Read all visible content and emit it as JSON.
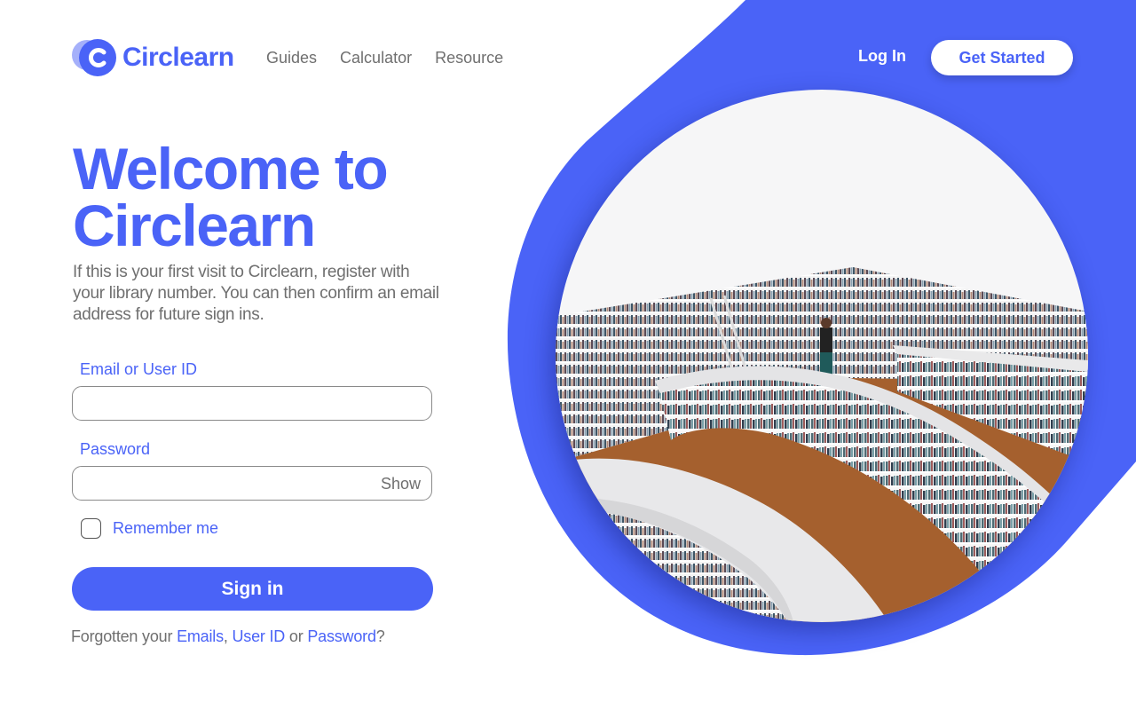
{
  "brand": {
    "name": "Circlearn"
  },
  "nav": {
    "items": [
      "Guides",
      "Calculator",
      "Resource"
    ],
    "login_label": "Log In",
    "cta_label": "Get Started"
  },
  "hero": {
    "title_line1": "Welcome to",
    "title_line2": "Circlearn",
    "intro": "If this is your first visit to Circlearn, register with your library number. You can then confirm an email address for future sign ins."
  },
  "form": {
    "email_label": "Email or User ID",
    "email_value": "",
    "password_label": "Password",
    "password_value": "",
    "show_label": "Show",
    "remember_label": "Remember me",
    "remember_checked": false,
    "submit_label": "Sign in"
  },
  "forgot": {
    "prefix": "Forgotten your ",
    "emails": "Emails",
    "sep1": ", ",
    "user_id": "User ID",
    "sep2": " or ",
    "password": "Password",
    "suffix": "?"
  },
  "colors": {
    "accent": "#4a63f7",
    "text_muted": "#6f6f6f",
    "background": "#ffffff"
  },
  "icons": {
    "logo": "circle-c-logo-icon"
  }
}
